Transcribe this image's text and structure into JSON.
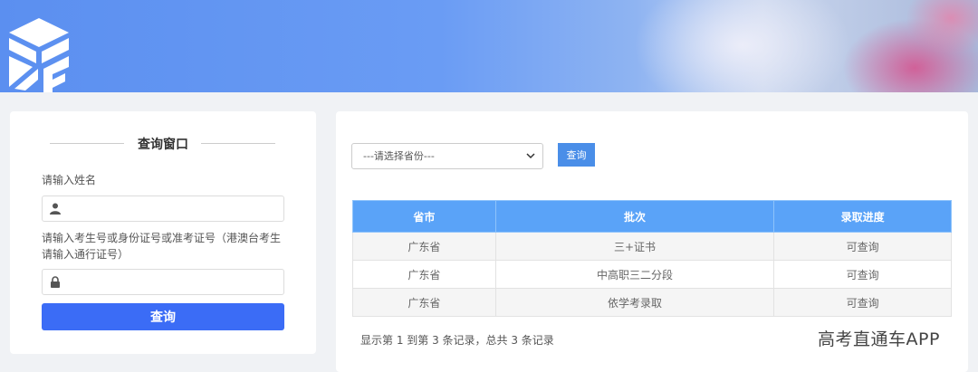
{
  "login": {
    "title": "查询窗口",
    "name_label": "请输入姓名",
    "name_value": "",
    "id_label_line1": "请输入考生号或身份证号或准考证号（港澳台考生",
    "id_label_line2": "请输入通行证号）",
    "id_value": "",
    "submit_label": "查询"
  },
  "filter": {
    "province_select": "---请选择省份---",
    "query_label": "查询"
  },
  "table": {
    "headers": [
      "省市",
      "批次",
      "录取进度"
    ],
    "rows": [
      [
        "广东省",
        "三+证书",
        "可查询"
      ],
      [
        "广东省",
        "中高职三二分段",
        "可查询"
      ],
      [
        "广东省",
        "依学考录取",
        "可查询"
      ]
    ]
  },
  "summary": "显示第 1 到第 3 条记录，总共 3 条记录",
  "watermark": "高考直通车APP",
  "colors": {
    "primary_button": "#3b6cf6",
    "table_header": "#5aa3f8",
    "query_button": "#4a8ee8"
  }
}
